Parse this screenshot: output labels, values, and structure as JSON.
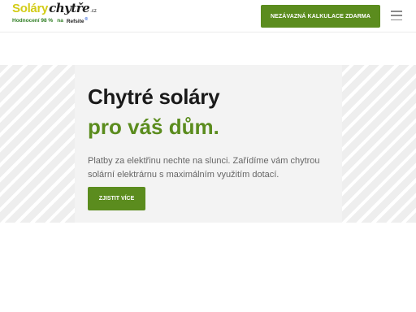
{
  "header": {
    "logo": {
      "part1": "Soláry",
      "part2": "chytře",
      "suffix": ".cz"
    },
    "rating": {
      "text": "Hodnocení 98 %",
      "na": "na",
      "refsite": "Refsite",
      "refsite_mark": "®"
    },
    "cta_label": "NEZÁVAZNÁ KALKULACE ZDARMA",
    "menu_icon": "hamburger-menu-icon"
  },
  "hero": {
    "title": "Chytré soláry",
    "subtitle": "pro váš dům.",
    "text": "Platby za elektřinu nechte na slunci. Zařídíme vám chytrou solární elektrárnu s maximálním využitím dotací.",
    "button_label": "ZJISTIT VÍCE"
  },
  "colors": {
    "brand_green": "#5b8c1e",
    "logo_yellow": "#d3cc17",
    "rating_green": "#2e7d22"
  }
}
